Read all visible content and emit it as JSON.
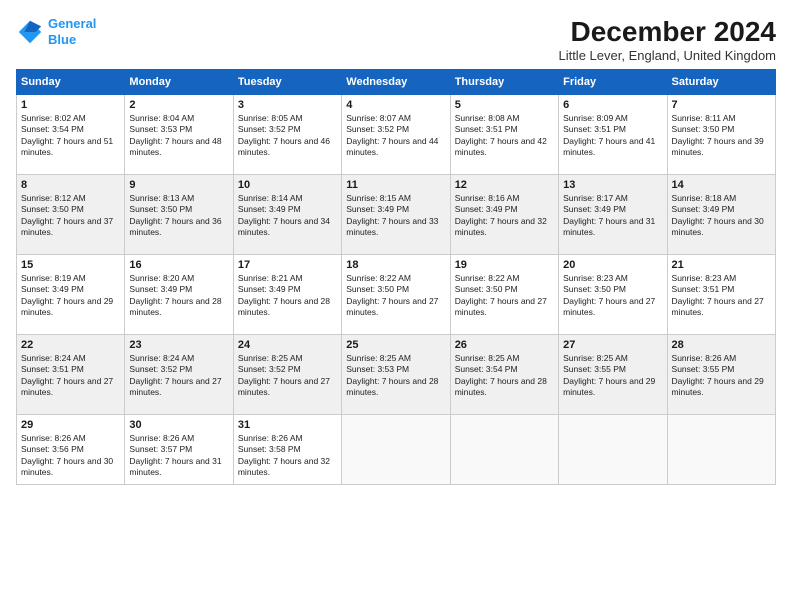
{
  "header": {
    "logo_line1": "General",
    "logo_line2": "Blue",
    "month": "December 2024",
    "location": "Little Lever, England, United Kingdom"
  },
  "weekdays": [
    "Sunday",
    "Monday",
    "Tuesday",
    "Wednesday",
    "Thursday",
    "Friday",
    "Saturday"
  ],
  "weeks": [
    [
      {
        "day": "1",
        "rise": "8:02 AM",
        "set": "3:54 PM",
        "daylight": "7 hours and 51 minutes."
      },
      {
        "day": "2",
        "rise": "8:04 AM",
        "set": "3:53 PM",
        "daylight": "7 hours and 48 minutes."
      },
      {
        "day": "3",
        "rise": "8:05 AM",
        "set": "3:52 PM",
        "daylight": "7 hours and 46 minutes."
      },
      {
        "day": "4",
        "rise": "8:07 AM",
        "set": "3:52 PM",
        "daylight": "7 hours and 44 minutes."
      },
      {
        "day": "5",
        "rise": "8:08 AM",
        "set": "3:51 PM",
        "daylight": "7 hours and 42 minutes."
      },
      {
        "day": "6",
        "rise": "8:09 AM",
        "set": "3:51 PM",
        "daylight": "7 hours and 41 minutes."
      },
      {
        "day": "7",
        "rise": "8:11 AM",
        "set": "3:50 PM",
        "daylight": "7 hours and 39 minutes."
      }
    ],
    [
      {
        "day": "8",
        "rise": "8:12 AM",
        "set": "3:50 PM",
        "daylight": "7 hours and 37 minutes."
      },
      {
        "day": "9",
        "rise": "8:13 AM",
        "set": "3:50 PM",
        "daylight": "7 hours and 36 minutes."
      },
      {
        "day": "10",
        "rise": "8:14 AM",
        "set": "3:49 PM",
        "daylight": "7 hours and 34 minutes."
      },
      {
        "day": "11",
        "rise": "8:15 AM",
        "set": "3:49 PM",
        "daylight": "7 hours and 33 minutes."
      },
      {
        "day": "12",
        "rise": "8:16 AM",
        "set": "3:49 PM",
        "daylight": "7 hours and 32 minutes."
      },
      {
        "day": "13",
        "rise": "8:17 AM",
        "set": "3:49 PM",
        "daylight": "7 hours and 31 minutes."
      },
      {
        "day": "14",
        "rise": "8:18 AM",
        "set": "3:49 PM",
        "daylight": "7 hours and 30 minutes."
      }
    ],
    [
      {
        "day": "15",
        "rise": "8:19 AM",
        "set": "3:49 PM",
        "daylight": "7 hours and 29 minutes."
      },
      {
        "day": "16",
        "rise": "8:20 AM",
        "set": "3:49 PM",
        "daylight": "7 hours and 28 minutes."
      },
      {
        "day": "17",
        "rise": "8:21 AM",
        "set": "3:49 PM",
        "daylight": "7 hours and 28 minutes."
      },
      {
        "day": "18",
        "rise": "8:22 AM",
        "set": "3:50 PM",
        "daylight": "7 hours and 27 minutes."
      },
      {
        "day": "19",
        "rise": "8:22 AM",
        "set": "3:50 PM",
        "daylight": "7 hours and 27 minutes."
      },
      {
        "day": "20",
        "rise": "8:23 AM",
        "set": "3:50 PM",
        "daylight": "7 hours and 27 minutes."
      },
      {
        "day": "21",
        "rise": "8:23 AM",
        "set": "3:51 PM",
        "daylight": "7 hours and 27 minutes."
      }
    ],
    [
      {
        "day": "22",
        "rise": "8:24 AM",
        "set": "3:51 PM",
        "daylight": "7 hours and 27 minutes."
      },
      {
        "day": "23",
        "rise": "8:24 AM",
        "set": "3:52 PM",
        "daylight": "7 hours and 27 minutes."
      },
      {
        "day": "24",
        "rise": "8:25 AM",
        "set": "3:52 PM",
        "daylight": "7 hours and 27 minutes."
      },
      {
        "day": "25",
        "rise": "8:25 AM",
        "set": "3:53 PM",
        "daylight": "7 hours and 28 minutes."
      },
      {
        "day": "26",
        "rise": "8:25 AM",
        "set": "3:54 PM",
        "daylight": "7 hours and 28 minutes."
      },
      {
        "day": "27",
        "rise": "8:25 AM",
        "set": "3:55 PM",
        "daylight": "7 hours and 29 minutes."
      },
      {
        "day": "28",
        "rise": "8:26 AM",
        "set": "3:55 PM",
        "daylight": "7 hours and 29 minutes."
      }
    ],
    [
      {
        "day": "29",
        "rise": "8:26 AM",
        "set": "3:56 PM",
        "daylight": "7 hours and 30 minutes."
      },
      {
        "day": "30",
        "rise": "8:26 AM",
        "set": "3:57 PM",
        "daylight": "7 hours and 31 minutes."
      },
      {
        "day": "31",
        "rise": "8:26 AM",
        "set": "3:58 PM",
        "daylight": "7 hours and 32 minutes."
      },
      null,
      null,
      null,
      null
    ]
  ]
}
